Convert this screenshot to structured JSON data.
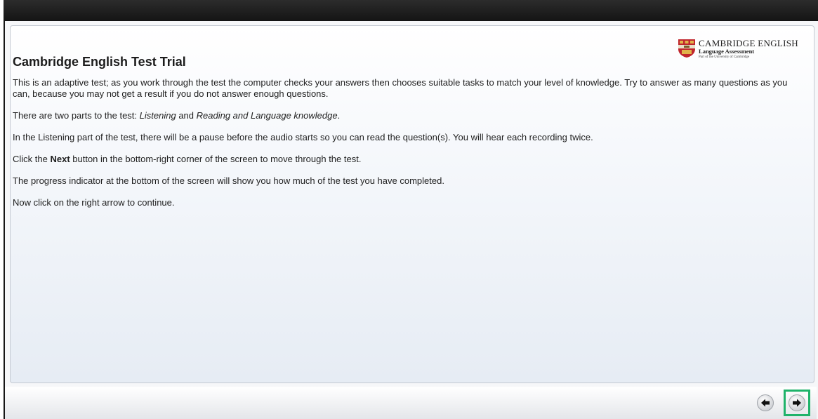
{
  "logo": {
    "main": "CAMBRIDGE ENGLISH",
    "sub": "Language Assessment",
    "tiny": "Part of the University of Cambridge"
  },
  "page": {
    "title": "Cambridge English Test Trial",
    "para1": "This is an adaptive test; as you work through the test the computer checks your answers then chooses suitable tasks to match your level of knowledge. Try to answer as many questions as you can, because you may not get a result if you do not answer enough questions.",
    "para2_prefix": "There are two parts to the test: ",
    "para2_part1": "Listening",
    "para2_and": " and ",
    "para2_part2": "Reading and Language knowledge",
    "para2_suffix": ".",
    "para3": "In the Listening part of the test, there will be a pause before the audio starts so you can read the question(s). You will hear each recording twice.",
    "para4_prefix": "Click the ",
    "para4_bold": "Next",
    "para4_suffix": " button in the bottom-right corner of the screen to move through the test.",
    "para5": "The progress indicator at the bottom of the screen will show you how much of the test you have completed.",
    "para6": "Now click on the right arrow to continue."
  },
  "nav": {
    "back_icon": "arrow-left-icon",
    "next_icon": "arrow-right-icon",
    "highlight_color": "#1fb36a"
  }
}
